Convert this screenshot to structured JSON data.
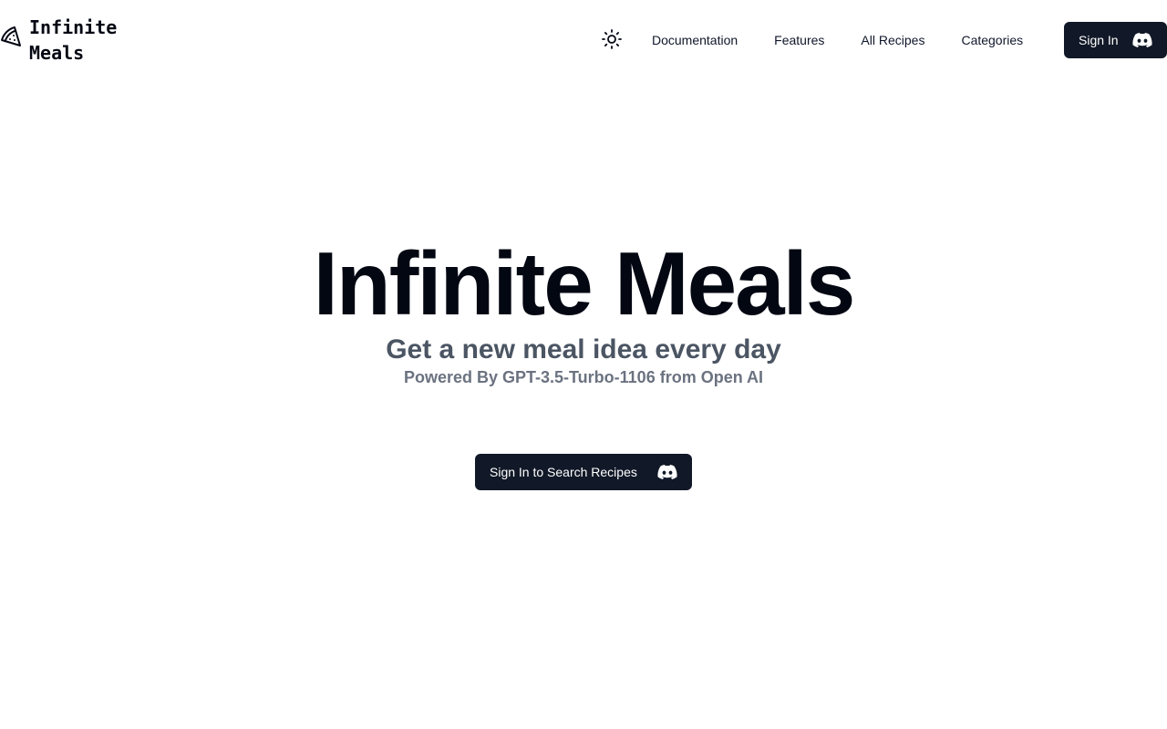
{
  "brand": {
    "line1": "Infinite",
    "line2": "Meals",
    "icon": "pizza-icon"
  },
  "header": {
    "theme_toggle_icon": "sun-icon",
    "nav": [
      {
        "label": "Documentation"
      },
      {
        "label": "Features"
      },
      {
        "label": "All Recipes"
      },
      {
        "label": "Categories"
      }
    ],
    "signin": {
      "label": "Sign In",
      "icon": "discord-icon"
    }
  },
  "hero": {
    "title": "Infinite Meals",
    "subtitle": "Get a new meal idea every day",
    "powered": "Powered By GPT-3.5-Turbo-1106 from Open AI"
  },
  "cta": {
    "label": "Sign In to Search Recipes",
    "icon": "discord-icon"
  },
  "colors": {
    "button_bg": "#111827",
    "title": "#030712",
    "subtitle": "#4b5563",
    "muted": "#6b7280"
  }
}
